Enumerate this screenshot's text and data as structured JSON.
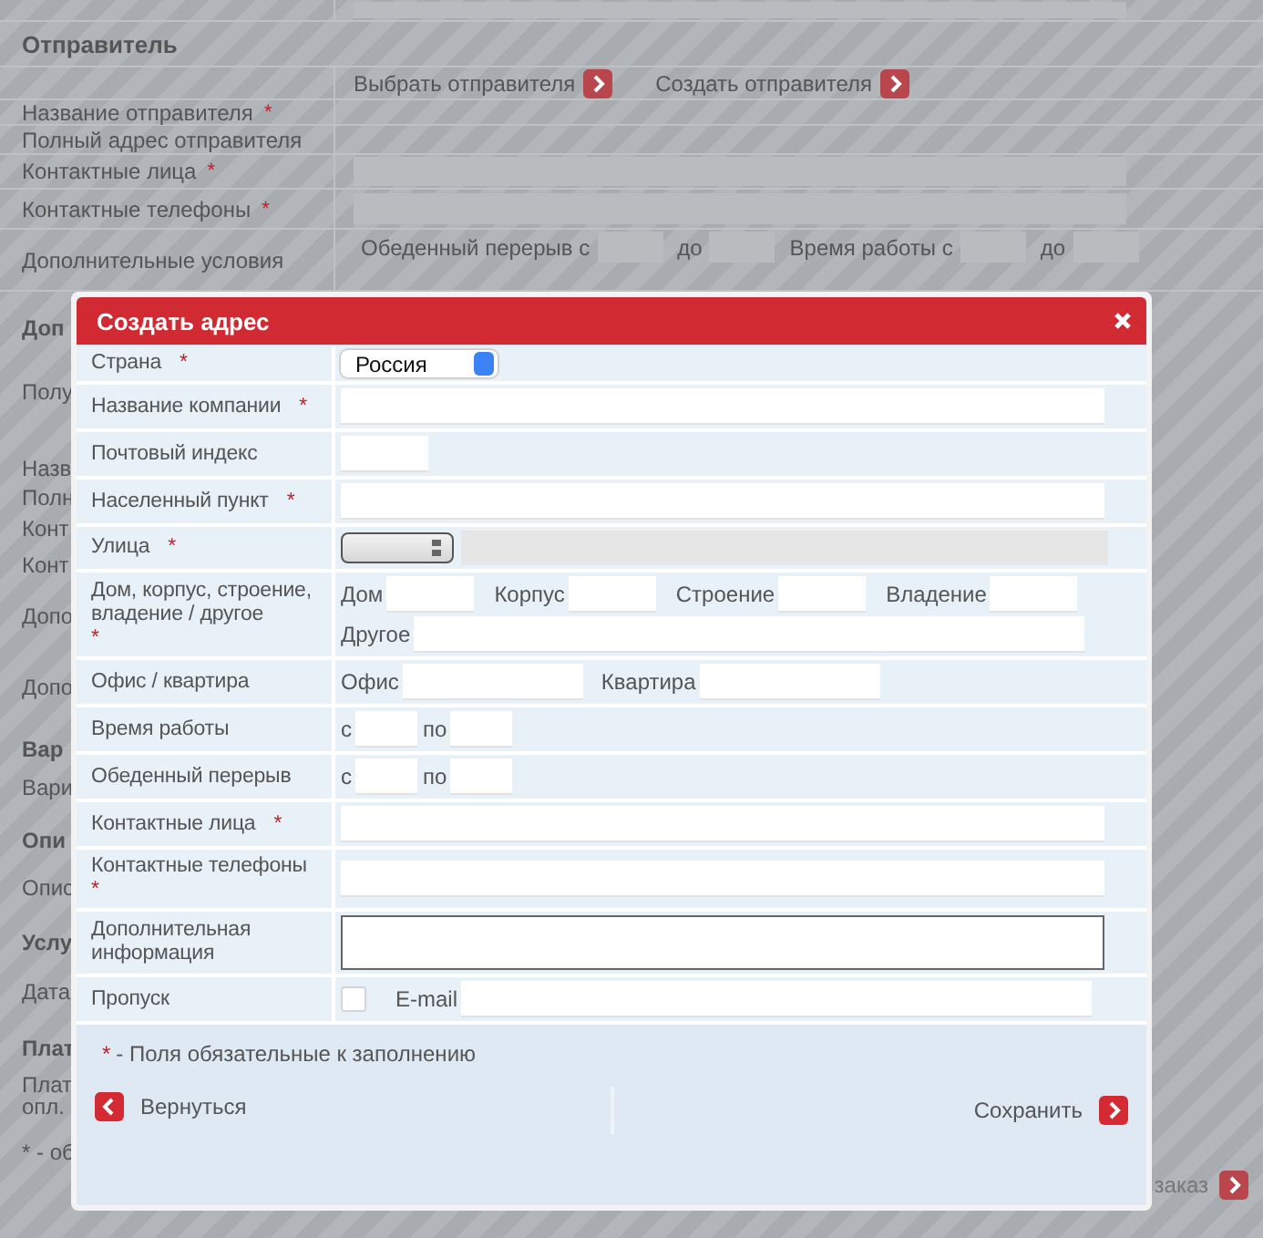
{
  "background_page": {
    "section_title": "Отправитель",
    "actions": [
      {
        "label": "Выбрать отправителя"
      },
      {
        "label": "Создать отправителя"
      }
    ],
    "rows": [
      {
        "label": "Название отправителя",
        "required_mark": "*",
        "kind": "plain"
      },
      {
        "label": "Полный адрес отправителя",
        "kind": "plain"
      },
      {
        "label": "Контактные лица",
        "required_mark": "*",
        "kind": "input"
      },
      {
        "label": "Контактные телефоны",
        "required_mark": "*",
        "kind": "input"
      },
      {
        "label": "Дополнительные условия",
        "kind": "conditions",
        "lines": [
          [
            "Обеденный перерыв с",
            "до",
            "Время работы с",
            "до"
          ]
        ]
      }
    ],
    "left_fragments": [
      {
        "text": "Доп",
        "kind": "heading"
      },
      {
        "text": "Полу",
        "kind": "section"
      },
      {
        "text": "Назв",
        "kind": "tight"
      },
      {
        "text": "Полн",
        "kind": "tight"
      },
      {
        "text": "Конт",
        "kind": "tight"
      },
      {
        "text": "Конт",
        "kind": "label"
      },
      {
        "text": "Допо",
        "kind": "tall"
      },
      {
        "text": "Допо",
        "kind": "tall"
      },
      {
        "text": "Вар",
        "kind": "heading"
      },
      {
        "text": "Вари",
        "kind": "label"
      },
      {
        "text": "Опи",
        "kind": "heading"
      },
      {
        "text": "Опис",
        "kind": "label"
      },
      {
        "text": "Услу",
        "kind": "heading"
      },
      {
        "text": "Дата",
        "kind": "label"
      },
      {
        "text": "Плат",
        "kind": "heading"
      },
      {
        "text": "Плат\nопл.",
        "kind": "label"
      },
      {
        "text": "* - об",
        "kind": "label"
      }
    ],
    "corner_button": {
      "label": "заказ"
    }
  },
  "dialog": {
    "title": "Создать адрес",
    "rows": [
      {
        "label": "Страна",
        "required_mark": "*",
        "lines": [
          [
            {
              "kind": "country-select",
              "value": "Россия"
            }
          ]
        ]
      },
      {
        "label": "Название компании",
        "required_mark": "*",
        "lines": [
          [
            {
              "kind": "wide"
            }
          ]
        ]
      },
      {
        "label": "Почтовый индекс",
        "lines": [
          [
            {
              "kind": "short"
            }
          ]
        ]
      },
      {
        "label": "Населенный пункт",
        "required_mark": "*",
        "lines": [
          [
            {
              "kind": "wide"
            }
          ]
        ]
      },
      {
        "label": "Улица",
        "required_mark": "*",
        "lines": [
          [
            {
              "kind": "street-select"
            },
            {
              "kind": "locked"
            }
          ]
        ]
      },
      {
        "label": "Дом, корпус, строение, владение / другое",
        "required_mark": "*",
        "lines": [
          [
            {
              "kind": "house",
              "label": "Дом"
            },
            {
              "kind": "house",
              "label": "Корпус"
            },
            {
              "kind": "house",
              "label": "Строение"
            },
            {
              "kind": "house",
              "label": "Владение"
            }
          ],
          [
            {
              "kind": "other",
              "label": "Другое"
            }
          ]
        ]
      },
      {
        "label": "Офис / квартира",
        "lines": [
          [
            {
              "kind": "office",
              "label": "Офис"
            },
            {
              "kind": "office",
              "label": "Квартира"
            }
          ]
        ]
      },
      {
        "label": "Время работы",
        "lines": [
          [
            {
              "kind": "time",
              "label": "с"
            },
            {
              "kind": "time",
              "label": "по"
            }
          ]
        ]
      },
      {
        "label": "Обеденный перерыв",
        "lines": [
          [
            {
              "kind": "time",
              "label": "с"
            },
            {
              "kind": "time",
              "label": "по"
            }
          ]
        ]
      },
      {
        "label": "Контактные лица",
        "required_mark": "*",
        "lines": [
          [
            {
              "kind": "wide"
            }
          ]
        ]
      },
      {
        "label": "Контактные телефоны",
        "required_mark": "*",
        "lines": [
          [
            {
              "kind": "wide"
            }
          ]
        ]
      },
      {
        "label": "Дополнительная информация",
        "lines": [
          [
            {
              "kind": "textarea"
            }
          ]
        ]
      },
      {
        "label": "Пропуск",
        "lines": [
          [
            {
              "kind": "checkbox",
              "checked": false
            },
            {
              "kind": "email",
              "label": "E-mail"
            }
          ]
        ]
      }
    ],
    "required_note": {
      "mark": "*",
      "text": "- Поля обязательные к заполнению"
    },
    "back_button": {
      "label": "Вернуться"
    },
    "save_button": {
      "label": "Сохранить"
    }
  }
}
